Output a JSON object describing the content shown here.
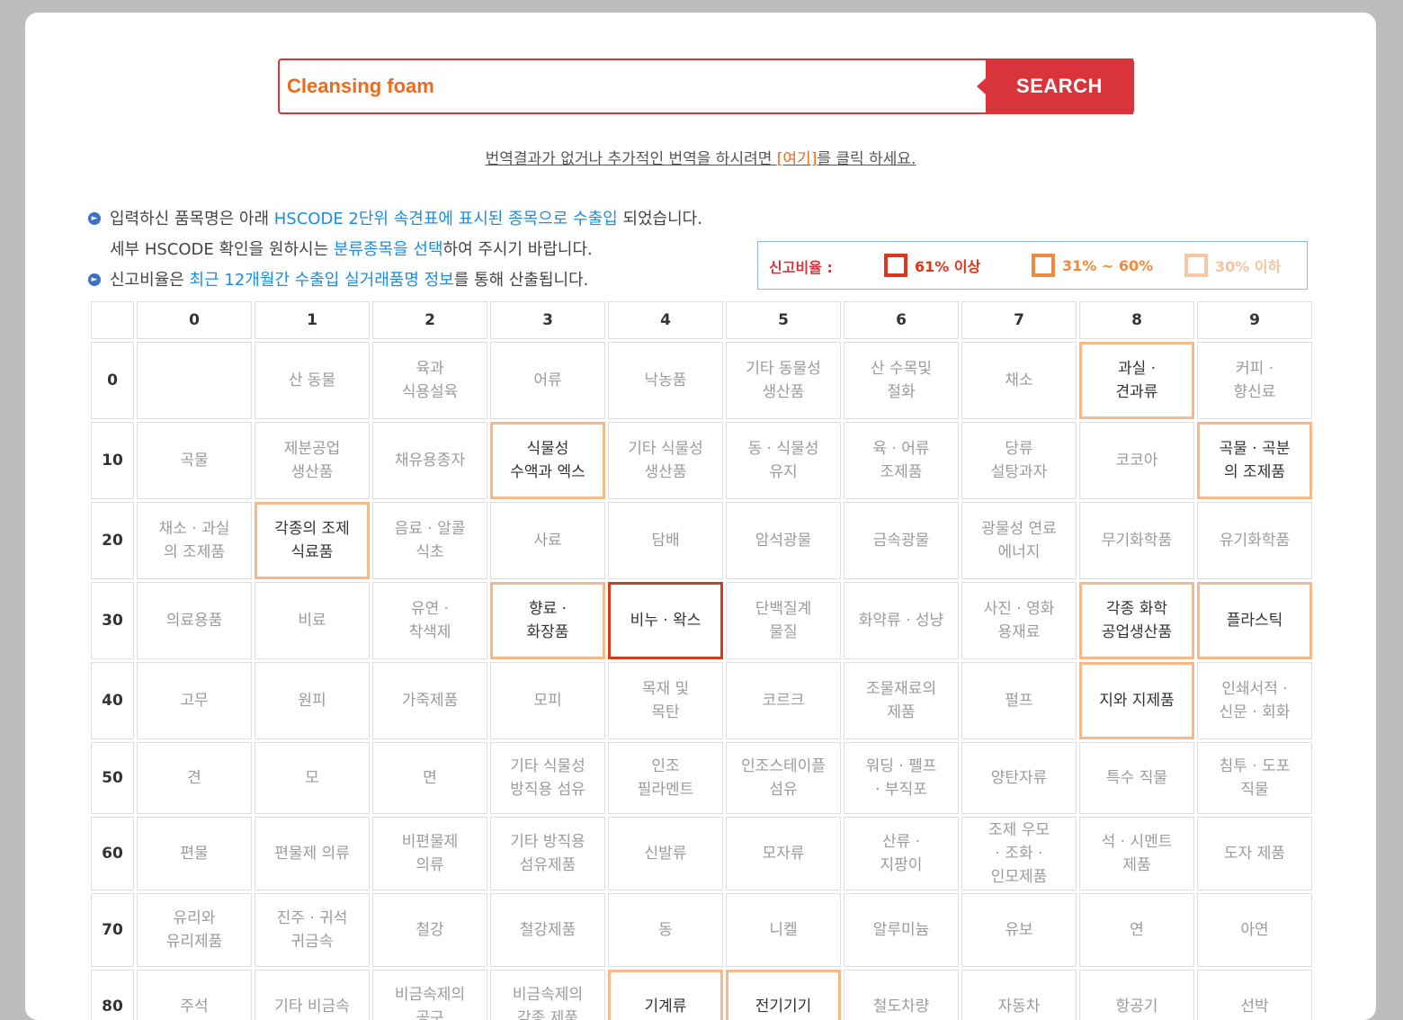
{
  "search": {
    "query": "Cleansing foam",
    "button_label": "SEARCH"
  },
  "translate_note": {
    "before": "번역결과가 없거나 추가적인 번역을 하시려면 ",
    "link": "[여기]",
    "after": "를 클릭 하세요."
  },
  "info": {
    "line1_a": "입력하신 품목명은 아래 ",
    "line1_b": "HSCODE 2단위 속견표에 표시된 종목으로 수출입",
    "line1_c": " 되었습니다.",
    "line2_a": "세부 HSCODE 확인을 원하시는 ",
    "line2_b": "분류종목을 선택",
    "line2_c": "하여 주시기 바랍니다.",
    "line3_a": "신고비율은 ",
    "line3_b": "최근 12개월간 수출입 실거래품명 정보",
    "line3_c": "를 통해 산출됩니다."
  },
  "legend": {
    "title": "신고비율 :",
    "high": "61% 이상",
    "mid": "31% ~ 60%",
    "low": "30% 이하",
    "colors": {
      "high": "#d83b1c",
      "mid": "#f08a3c",
      "low": "#f7c8a6"
    }
  },
  "grid": {
    "columns": [
      "0",
      "1",
      "2",
      "3",
      "4",
      "5",
      "6",
      "7",
      "8",
      "9"
    ],
    "rows": [
      {
        "label": "0",
        "cells": [
          {
            "t": ""
          },
          {
            "t": "산 동물"
          },
          {
            "t": "육과\n식용설육"
          },
          {
            "t": "어류"
          },
          {
            "t": "낙농품"
          },
          {
            "t": "기타 동물성\n생산품"
          },
          {
            "t": "산 수목및\n절화"
          },
          {
            "t": "채소"
          },
          {
            "t": "과실 ·\n견과류",
            "lvl": 2
          },
          {
            "t": "커피 ·\n향신료"
          }
        ]
      },
      {
        "label": "10",
        "cells": [
          {
            "t": "곡물"
          },
          {
            "t": "제분공업\n생산품"
          },
          {
            "t": "채유용종자"
          },
          {
            "t": "식물성\n수액과 엑스",
            "lvl": 2
          },
          {
            "t": "기타 식물성\n생산품"
          },
          {
            "t": "동 · 식물성\n유지"
          },
          {
            "t": "육 · 어류\n조제품"
          },
          {
            "t": "당류\n설탕과자"
          },
          {
            "t": "코코아"
          },
          {
            "t": "곡물 · 곡분\n의 조제품",
            "lvl": 2
          }
        ]
      },
      {
        "label": "20",
        "cells": [
          {
            "t": "채소 · 과실\n의 조제품"
          },
          {
            "t": "각종의 조제\n식료품",
            "lvl": 2
          },
          {
            "t": "음료 · 알콜\n식초"
          },
          {
            "t": "사료"
          },
          {
            "t": "담배"
          },
          {
            "t": "암석광물"
          },
          {
            "t": "금속광물"
          },
          {
            "t": "광물성 연료\n에너지"
          },
          {
            "t": "무기화학품"
          },
          {
            "t": "유기화학품"
          }
        ]
      },
      {
        "label": "30",
        "cells": [
          {
            "t": "의료용품"
          },
          {
            "t": "비료"
          },
          {
            "t": "유연 ·\n착색제"
          },
          {
            "t": "향료 ·\n화장품",
            "lvl": 2
          },
          {
            "t": "비누 · 왁스",
            "lvl": 1
          },
          {
            "t": "단백질계\n물질"
          },
          {
            "t": "화약류 · 성냥"
          },
          {
            "t": "사진 · 영화\n용재료"
          },
          {
            "t": "각종 화학\n공업생산품",
            "lvl": 2
          },
          {
            "t": "플라스틱",
            "lvl": 2
          }
        ]
      },
      {
        "label": "40",
        "cells": [
          {
            "t": "고무"
          },
          {
            "t": "원피"
          },
          {
            "t": "가죽제품"
          },
          {
            "t": "모피"
          },
          {
            "t": "목재 및\n목탄"
          },
          {
            "t": "코르크"
          },
          {
            "t": "조물재료의\n제품"
          },
          {
            "t": "펄프"
          },
          {
            "t": "지와 지제품",
            "lvl": 2
          },
          {
            "t": "인쇄서적 ·\n신문 · 회화"
          }
        ]
      },
      {
        "label": "50",
        "cells": [
          {
            "t": "견"
          },
          {
            "t": "모"
          },
          {
            "t": "면"
          },
          {
            "t": "기타 식물성\n방직용 섬유"
          },
          {
            "t": "인조\n필라멘트"
          },
          {
            "t": "인조스테이플\n섬유"
          },
          {
            "t": "워딩 · 펠프\n· 부직포"
          },
          {
            "t": "양탄자류"
          },
          {
            "t": "특수 직물"
          },
          {
            "t": "침투 · 도포\n직물"
          }
        ]
      },
      {
        "label": "60",
        "cells": [
          {
            "t": "편물"
          },
          {
            "t": "편물제 의류"
          },
          {
            "t": "비편물제\n의류"
          },
          {
            "t": "기타 방직용\n섬유제품"
          },
          {
            "t": "신발류"
          },
          {
            "t": "모자류"
          },
          {
            "t": "산류 ·\n지팡이"
          },
          {
            "t": "조제 우모\n· 조화 ·\n인모제품"
          },
          {
            "t": "석 · 시멘트\n제품"
          },
          {
            "t": "도자 제품"
          }
        ]
      },
      {
        "label": "70",
        "cells": [
          {
            "t": "유리와\n유리제품"
          },
          {
            "t": "진주 · 귀석\n귀금속"
          },
          {
            "t": "철강"
          },
          {
            "t": "철강제품"
          },
          {
            "t": "동"
          },
          {
            "t": "니켈"
          },
          {
            "t": "알루미늄"
          },
          {
            "t": "유보"
          },
          {
            "t": "연"
          },
          {
            "t": "아연"
          }
        ]
      },
      {
        "label": "80",
        "cells": [
          {
            "t": "주석"
          },
          {
            "t": "기타 비금속"
          },
          {
            "t": "비금속제의\n공구"
          },
          {
            "t": "비금속제의\n각종 제품"
          },
          {
            "t": "기계류",
            "lvl": 2
          },
          {
            "t": "전기기기",
            "lvl": 2
          },
          {
            "t": "철도차량"
          },
          {
            "t": "자동차"
          },
          {
            "t": "항공기"
          },
          {
            "t": "선박"
          }
        ]
      }
    ]
  }
}
